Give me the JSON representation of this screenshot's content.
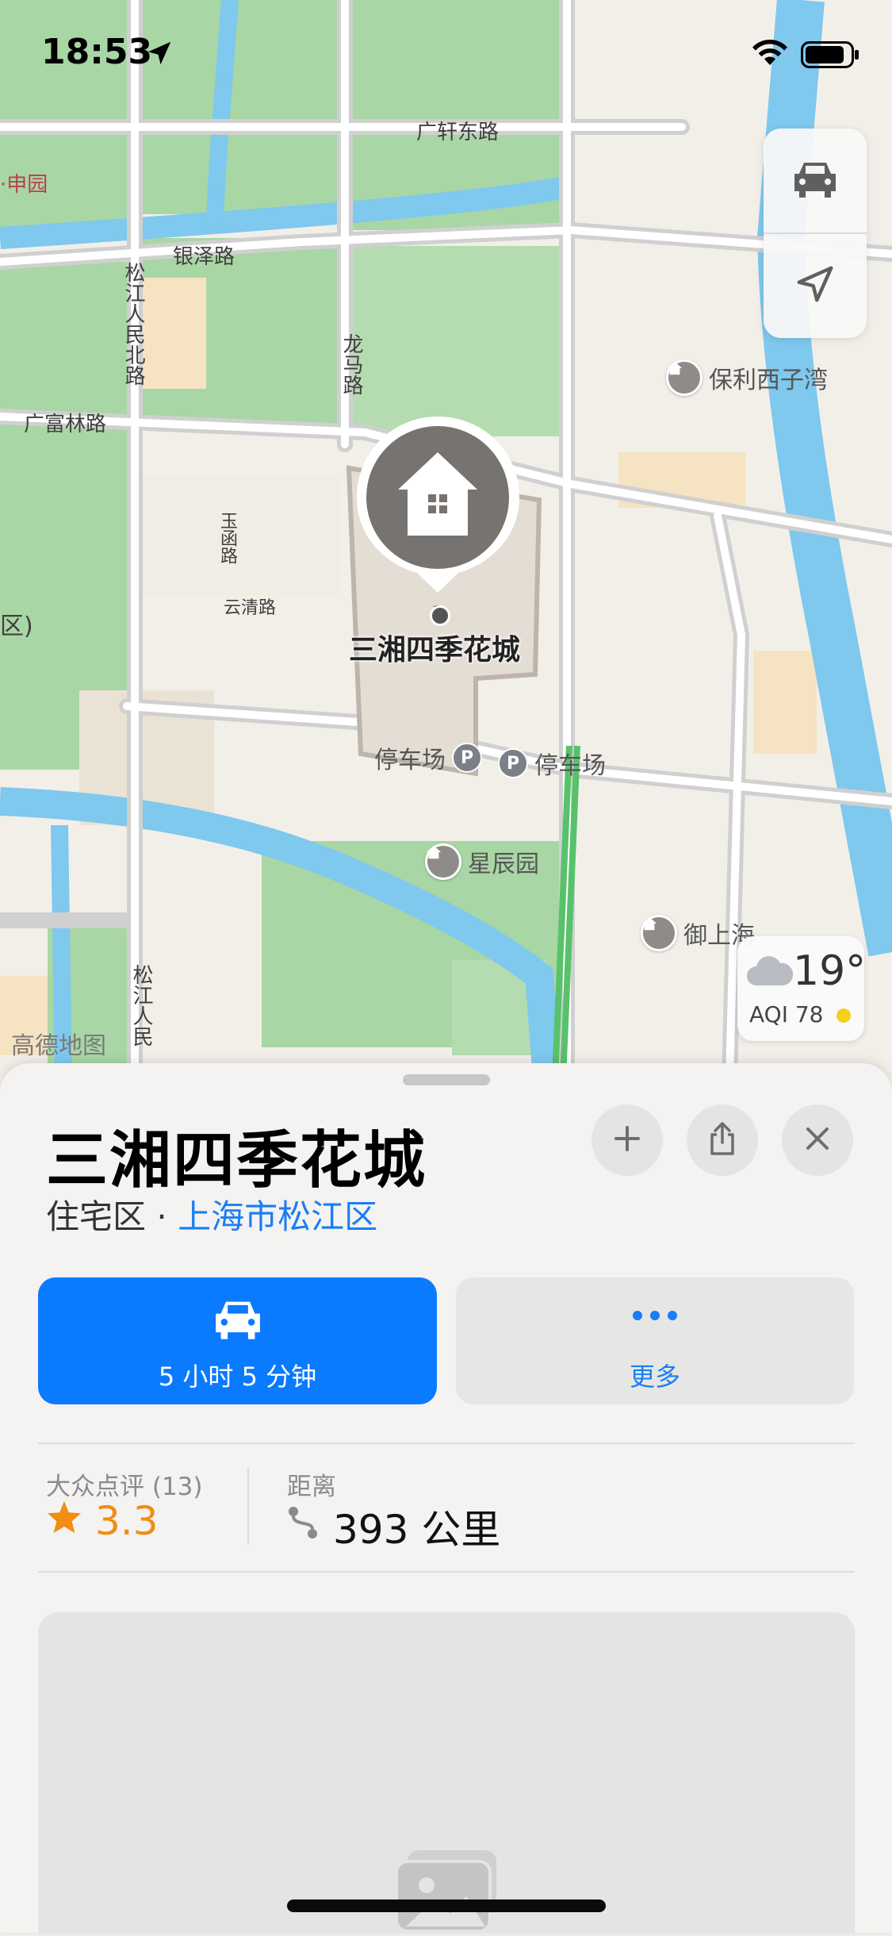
{
  "status_bar": {
    "time": "18:53"
  },
  "map": {
    "road_labels": [
      "广轩东路",
      "银泽路",
      "广富林路",
      "云清路",
      "松江人民北路",
      "龙马路",
      "玉函路",
      "松江人民"
    ],
    "district_labels": [
      "申园",
      "区)"
    ],
    "pois": [
      "保利西子湾",
      "星辰园",
      "御上海"
    ],
    "parking": [
      "停车场",
      "停车场"
    ],
    "pin_label": "三湘四季花城",
    "attribution": "高德地图",
    "weather": {
      "temperature": "19°",
      "aqi": "AQI 78",
      "aqi_color": "#f4d11b"
    }
  },
  "place": {
    "name": "三湘四季花城",
    "category": "住宅区",
    "separator": " · ",
    "location_link": "上海市松江区"
  },
  "actions": {
    "primary_label": "5 小时 5 分钟",
    "secondary_label": "更多",
    "primary_color": "#0a7aff"
  },
  "stats": {
    "rating_label": "大众点评 (13)",
    "rating_value": "3.3",
    "distance_label": "距离",
    "distance_value": "393 公里"
  },
  "icons": [
    "location-arrow-icon",
    "wifi-icon",
    "battery-icon",
    "car-icon",
    "navigate-arrow-icon",
    "house-icon",
    "plus-icon",
    "share-icon",
    "close-icon",
    "ellipsis-icon",
    "star-icon",
    "route-icon",
    "photo-icon"
  ]
}
